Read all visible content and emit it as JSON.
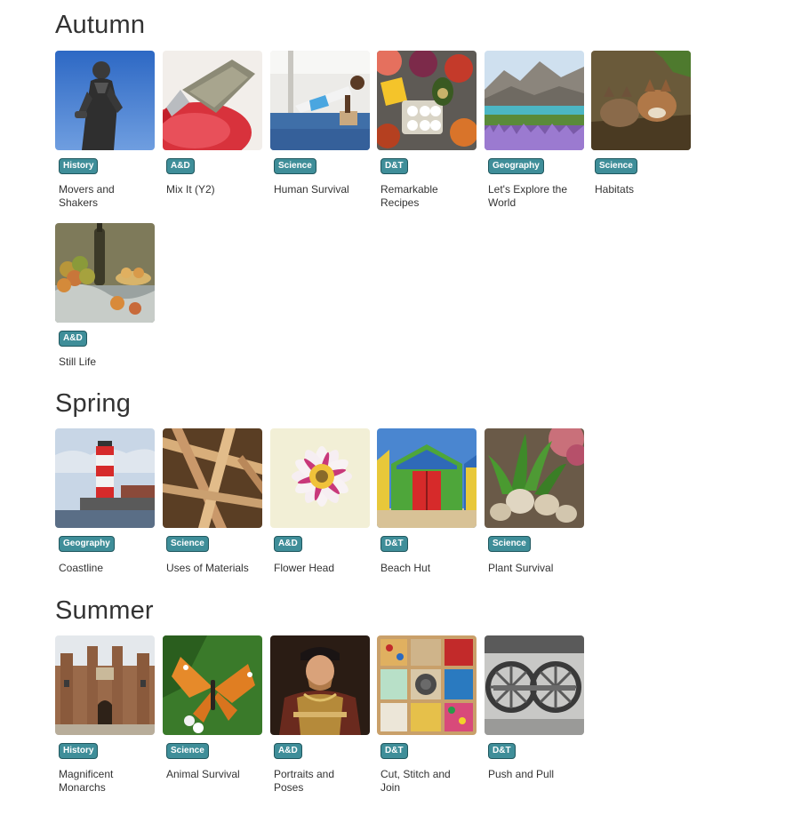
{
  "accent_color": "#3f8e99",
  "sections": [
    {
      "title": "Autumn",
      "units": [
        {
          "subject": "History",
          "title": "Movers and Shakers",
          "image": "statue-photo"
        },
        {
          "subject": "A&D",
          "title": "Mix It (Y2)",
          "image": "paintbrush-photo"
        },
        {
          "subject": "Science",
          "title": "Human Survival",
          "image": "exercise-photo"
        },
        {
          "subject": "D&T",
          "title": "Remarkable Recipes",
          "image": "food-photo"
        },
        {
          "subject": "Geography",
          "title": "Let's Explore the World",
          "image": "landscape-photo"
        },
        {
          "subject": "Science",
          "title": "Habitats",
          "image": "fox-cubs-photo"
        },
        {
          "subject": "A&D",
          "title": "Still Life",
          "image": "still-life-painting"
        }
      ]
    },
    {
      "title": "Spring",
      "units": [
        {
          "subject": "Geography",
          "title": "Coastline",
          "image": "lighthouse-photo"
        },
        {
          "subject": "Science",
          "title": "Uses of Materials",
          "image": "timber-frame-photo"
        },
        {
          "subject": "A&D",
          "title": "Flower Head",
          "image": "flower-photo"
        },
        {
          "subject": "D&T",
          "title": "Beach Hut",
          "image": "beach-huts-photo"
        },
        {
          "subject": "Science",
          "title": "Plant Survival",
          "image": "bulbs-photo"
        }
      ]
    },
    {
      "title": "Summer",
      "units": [
        {
          "subject": "History",
          "title": "Magnificent Monarchs",
          "image": "palace-photo"
        },
        {
          "subject": "Science",
          "title": "Animal Survival",
          "image": "butterfly-photo"
        },
        {
          "subject": "A&D",
          "title": "Portraits and Poses",
          "image": "portrait-painting"
        },
        {
          "subject": "D&T",
          "title": "Cut, Stitch and Join",
          "image": "buttons-photo"
        },
        {
          "subject": "D&T",
          "title": "Push and Pull",
          "image": "train-wheels-photo"
        }
      ]
    }
  ]
}
